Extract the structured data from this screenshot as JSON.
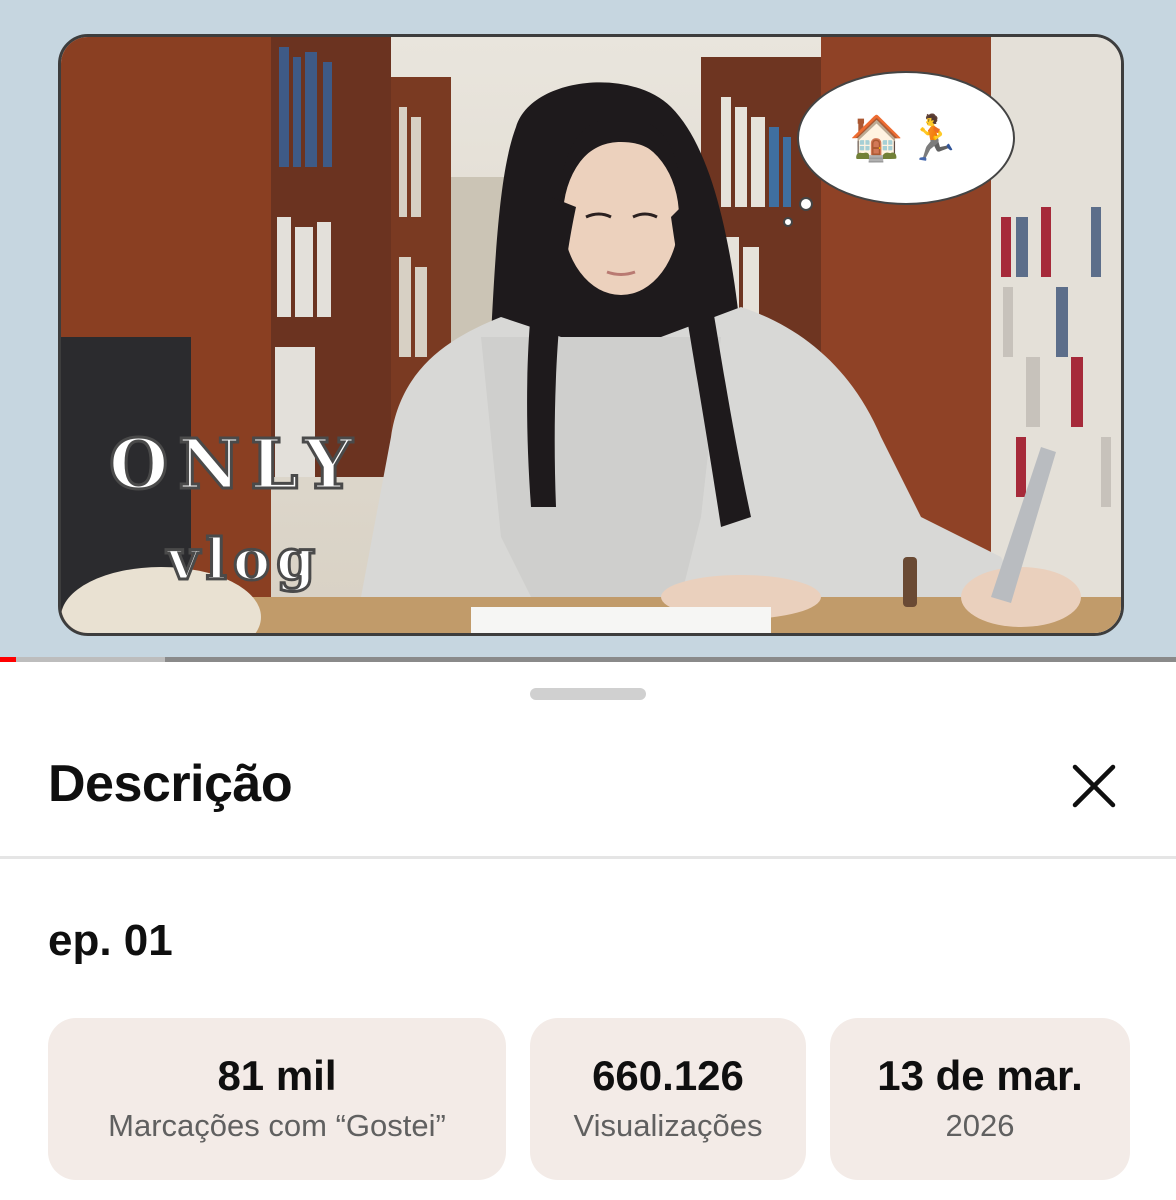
{
  "player": {
    "overlay_text": {
      "line1": "ONLY",
      "line2": "vlog"
    },
    "bubble_emoji": "🏠🏃",
    "progress_fraction": 0.014,
    "buffer_fraction": 0.14,
    "colors": {
      "progress": "#ff0000",
      "background": "#c6d6e0"
    }
  },
  "sheet": {
    "title": "Descrição",
    "close_icon": "close-icon",
    "video_title": "ep. 01",
    "stats": [
      {
        "value": "81 mil",
        "label": "Marcações com “Gostei”"
      },
      {
        "value": "660.126",
        "label": "Visualizações"
      },
      {
        "value": "13 de mar.",
        "label": "2026"
      }
    ]
  }
}
